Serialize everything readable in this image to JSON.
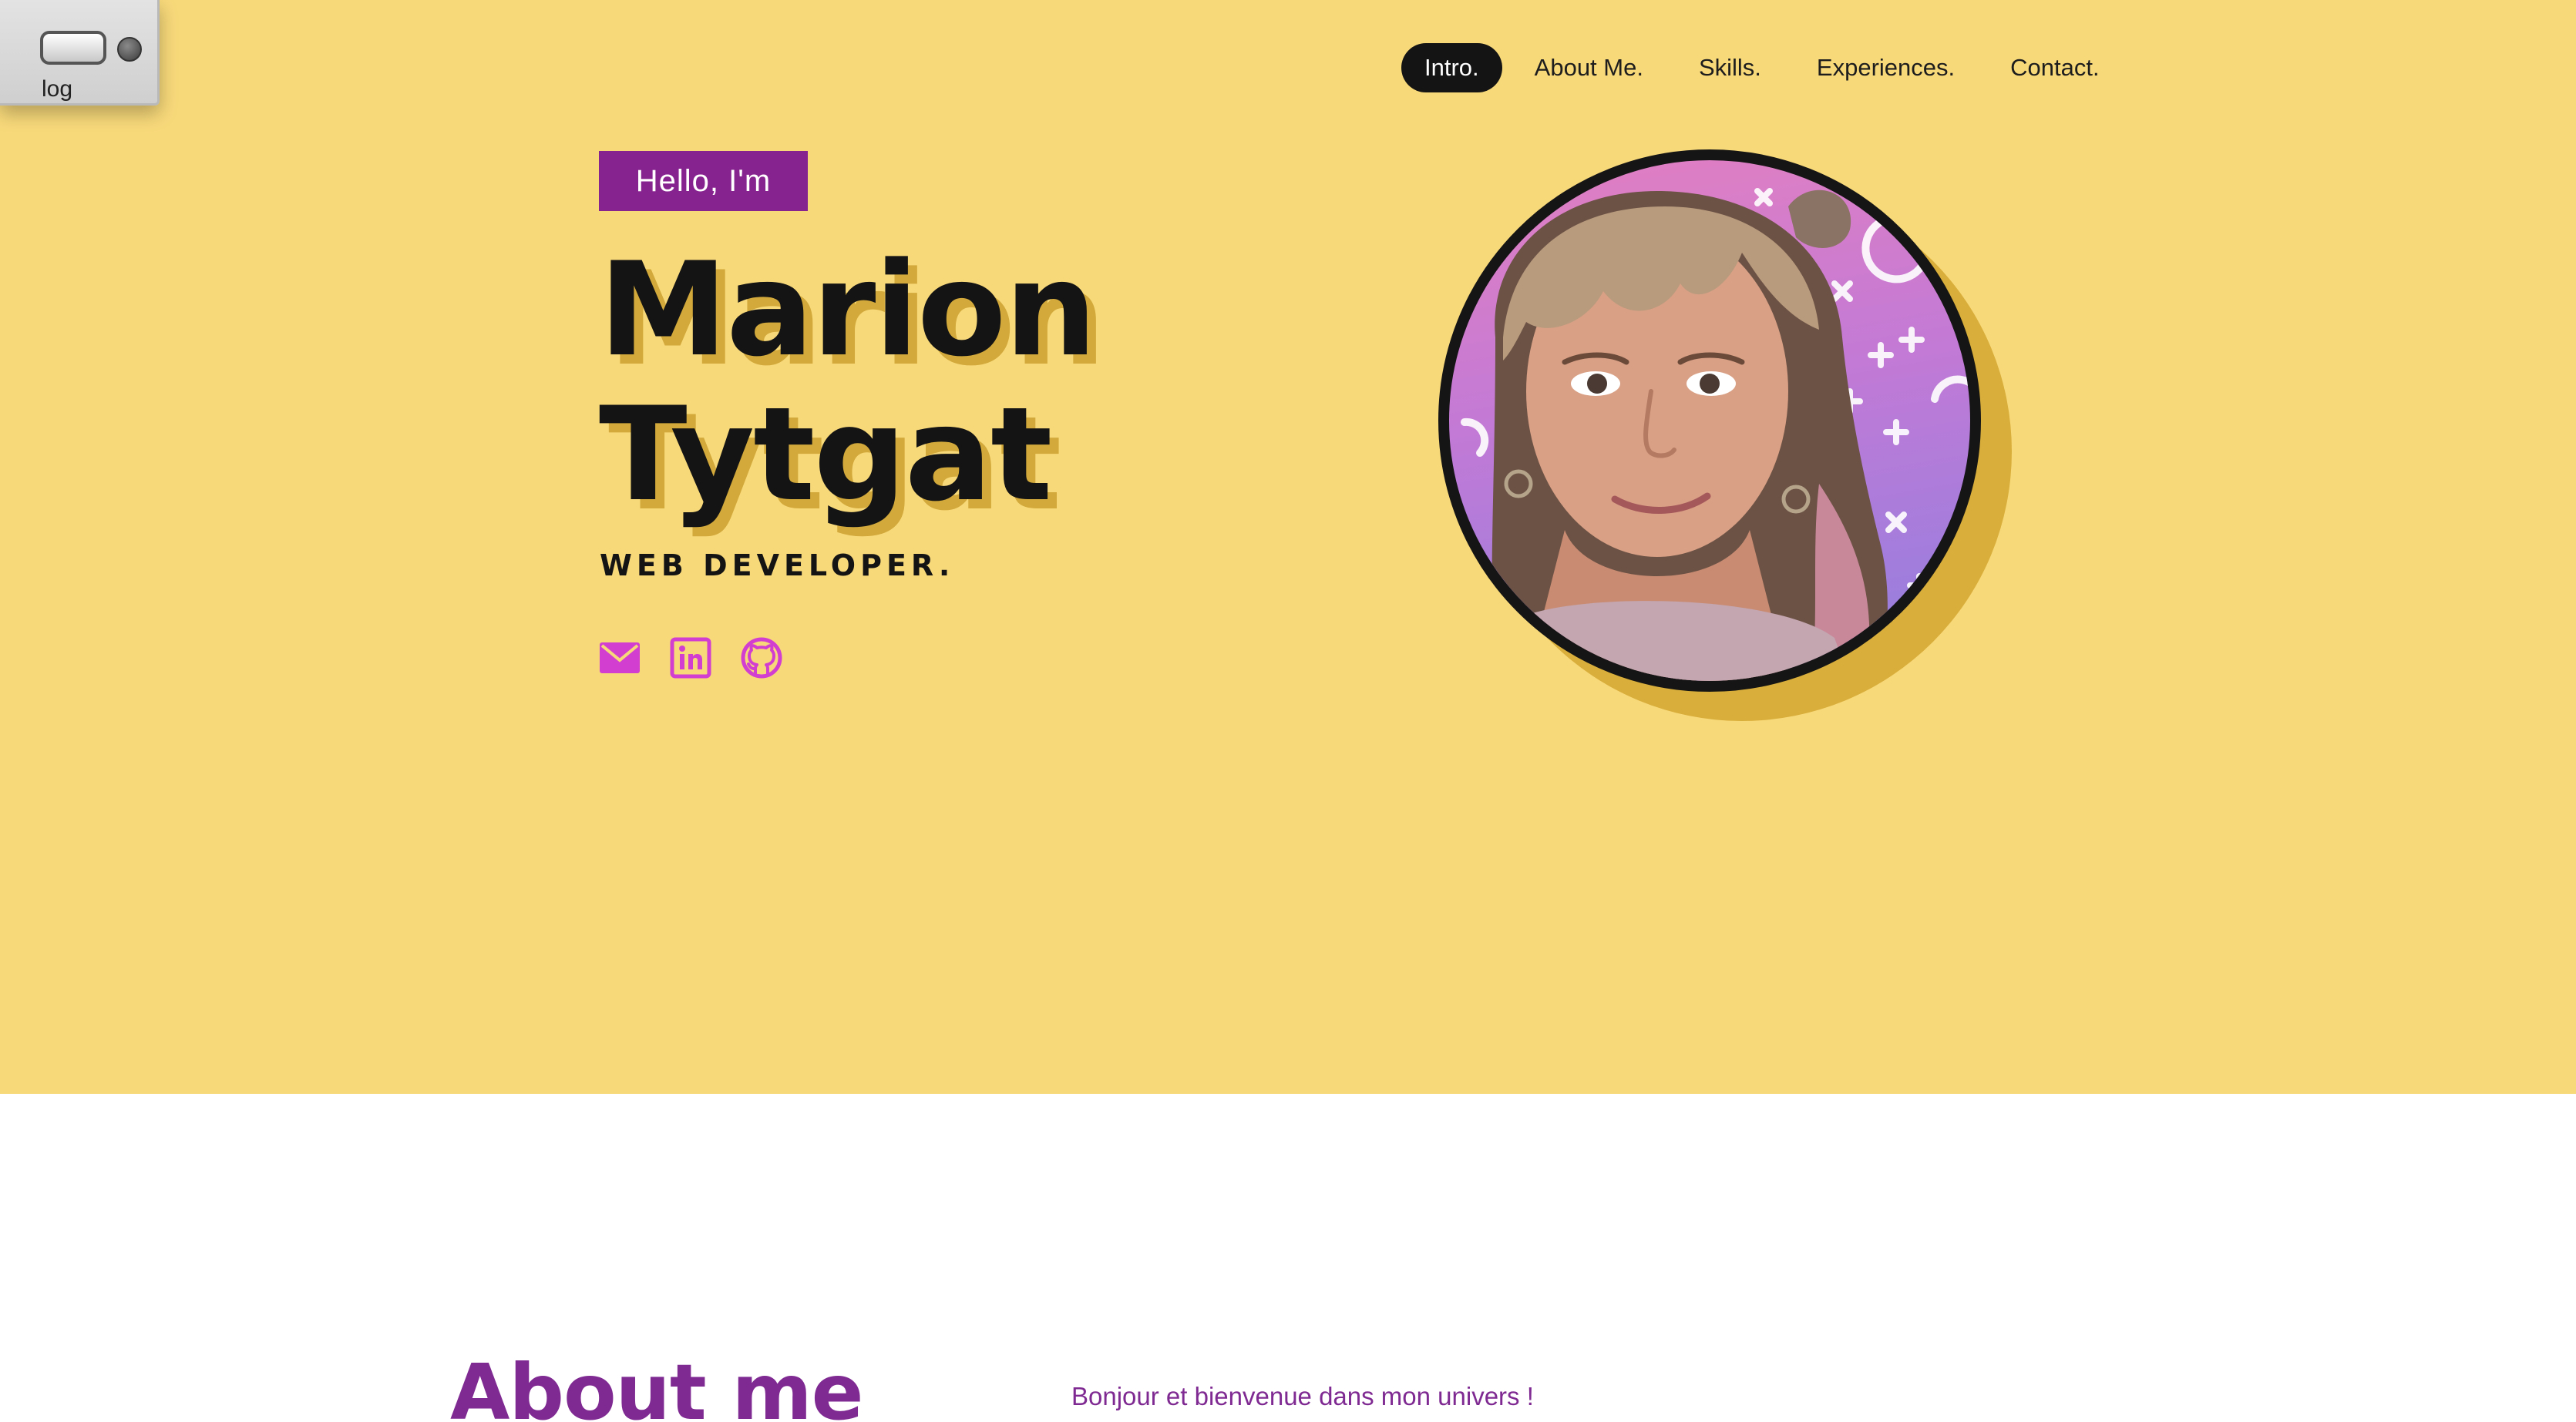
{
  "theme_toggle": {
    "label": "log"
  },
  "nav": {
    "items": [
      {
        "label": "Intro.",
        "active": true
      },
      {
        "label": "About Me.",
        "active": false
      },
      {
        "label": "Skills.",
        "active": false
      },
      {
        "label": "Experiences.",
        "active": false
      },
      {
        "label": "Contact.",
        "active": false
      }
    ]
  },
  "hero": {
    "greeting": "Hello, I'm",
    "first_name": "Marion",
    "last_name": "Tytgat",
    "role": "WEB DEVELOPER.",
    "socials": [
      {
        "icon": "mail-icon"
      },
      {
        "icon": "linkedin-icon"
      },
      {
        "icon": "github-icon"
      }
    ],
    "avatar": "profile-photo"
  },
  "about": {
    "heading": "About me",
    "intro": "Bonjour et bienvenue dans mon univers !"
  },
  "colors": {
    "hero_background": "#f8d97a",
    "accent_purple": "#87238f",
    "social_icon": "#d23fd0",
    "text_dark": "#141414",
    "name_shadow": "#d2a93a"
  }
}
